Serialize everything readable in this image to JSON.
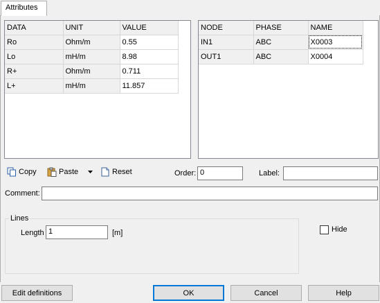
{
  "tab": {
    "label": "Attributes"
  },
  "left_grid": {
    "headers": [
      "DATA",
      "UNIT",
      "VALUE"
    ],
    "rows": [
      [
        "Ro",
        "Ohm/m",
        "0.55"
      ],
      [
        "Lo",
        "mH/m",
        "8.98"
      ],
      [
        "R+",
        "Ohm/m",
        "0.711"
      ],
      [
        "L+",
        "mH/m",
        "11.857"
      ]
    ]
  },
  "right_grid": {
    "headers": [
      "NODE",
      "PHASE",
      "NAME"
    ],
    "rows": [
      [
        "IN1",
        "ABC",
        "X0003"
      ],
      [
        "OUT1",
        "ABC",
        "X0004"
      ]
    ]
  },
  "toolbar": {
    "copy": "Copy",
    "paste": "Paste",
    "reset": "Reset"
  },
  "order": {
    "label": "Order:",
    "value": "0"
  },
  "label_field": {
    "label": "Label:",
    "value": ""
  },
  "comment": {
    "label": "Comment:",
    "value": ""
  },
  "lines_group": {
    "title": "Lines",
    "length_label": "Length",
    "length_value": "1",
    "unit": "[m]"
  },
  "hide": {
    "label": "Hide",
    "checked": false
  },
  "buttons": {
    "edit_definitions": "Edit definitions",
    "ok": "OK",
    "cancel": "Cancel",
    "help": "Help"
  }
}
